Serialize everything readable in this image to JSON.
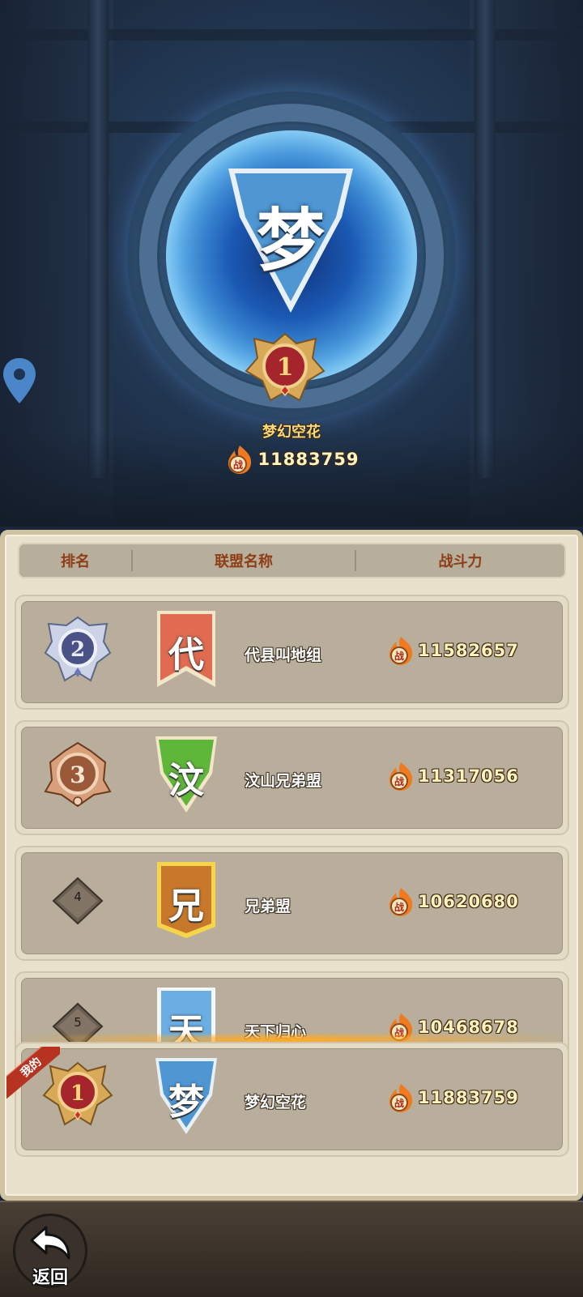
{
  "top": {
    "leader_glyph": "梦",
    "leader_rank": "1",
    "leader_name": "梦幻空花",
    "leader_power": "11883759",
    "banner_color": "#4f97d3"
  },
  "table": {
    "headers": {
      "rank": "排名",
      "name": "联盟名称",
      "power": "战斗力"
    },
    "rows": [
      {
        "rank": "2",
        "medal": "silver",
        "glyph": "代",
        "flag_color": "#e06b50",
        "name": "代县叫地组",
        "power": "11582657"
      },
      {
        "rank": "3",
        "medal": "bronze",
        "glyph": "汶",
        "flag_color": "#5fb73a",
        "name": "汶山兄弟盟",
        "power": "11317056"
      },
      {
        "rank": "4",
        "medal": "diamond",
        "glyph": "兄",
        "flag_color": "#c8782a",
        "name": "兄弟盟",
        "power": "10620680"
      },
      {
        "rank": "5",
        "medal": "diamond",
        "glyph": "天",
        "flag_color": "#6aaee4",
        "name": "天下归心",
        "power": "10468678"
      }
    ],
    "mine": {
      "tag": "我的",
      "rank": "1",
      "glyph": "梦",
      "flag_color": "#4f97d3",
      "name": "梦幻空花",
      "power": "11883759"
    }
  },
  "footer": {
    "back_label": "返回"
  },
  "icons": {
    "power": "battle-power-flame-icon",
    "location": "map-pin-icon",
    "back": "back-arrow-icon"
  }
}
